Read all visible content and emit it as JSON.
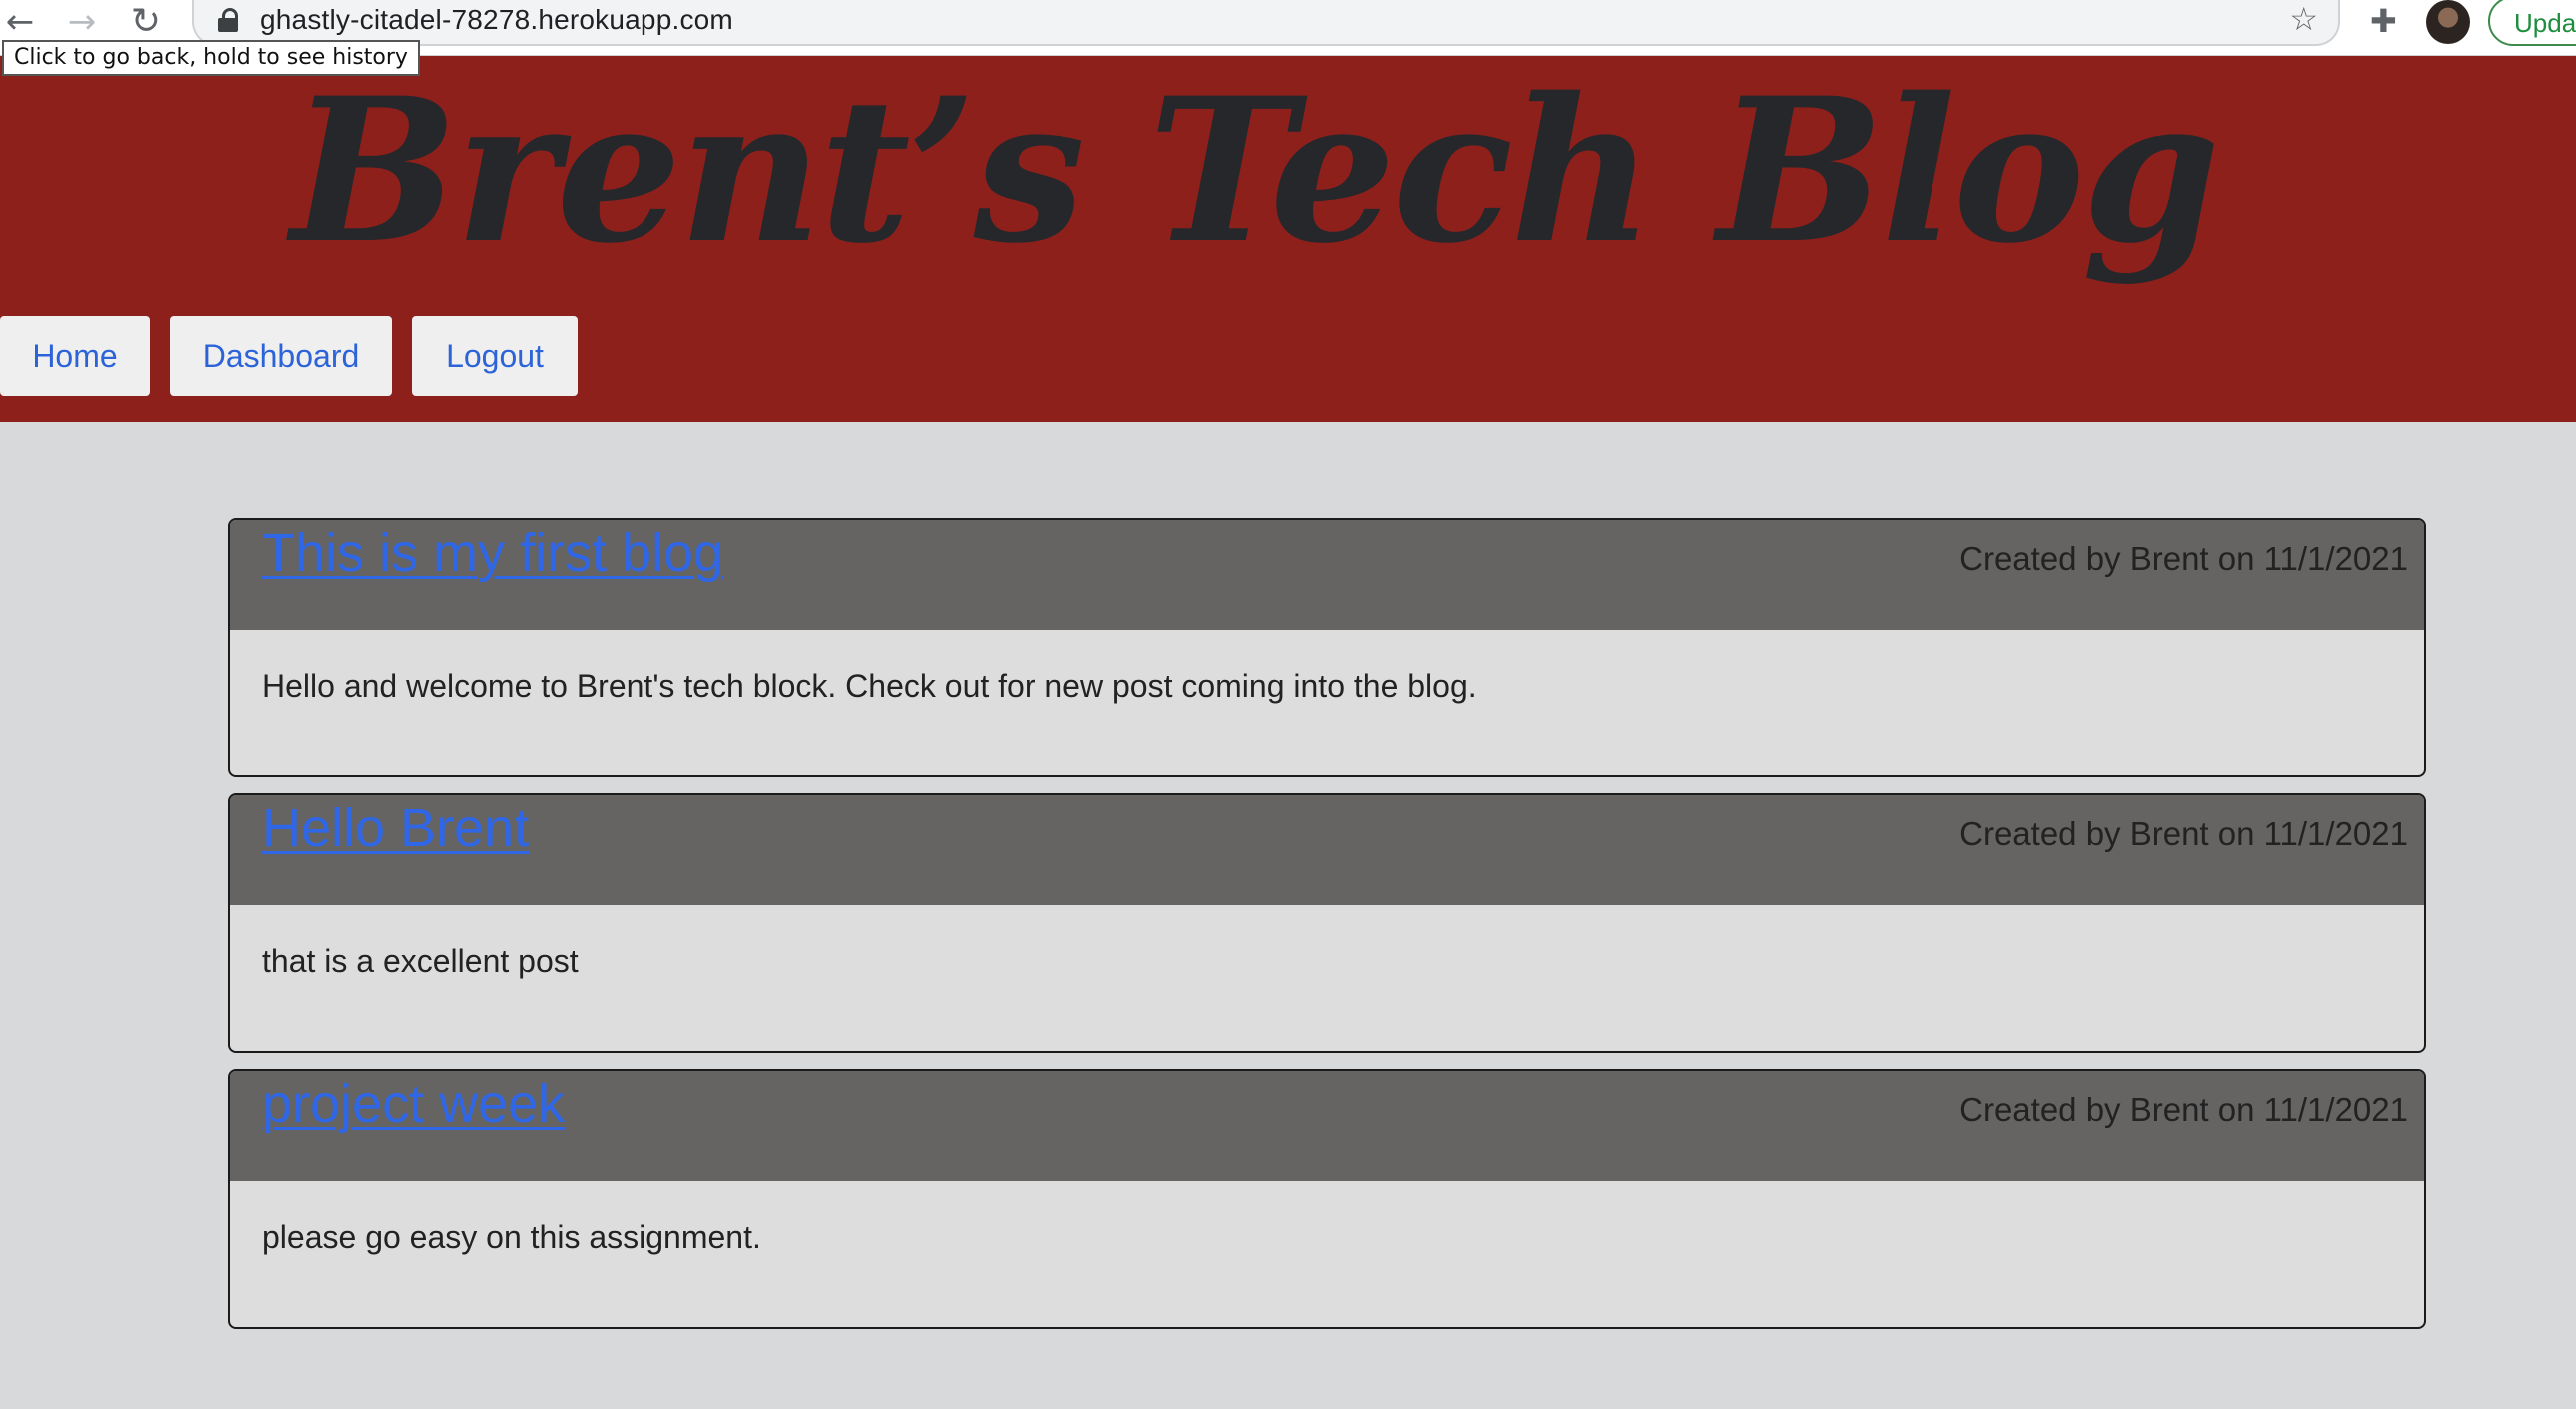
{
  "browser": {
    "url": "ghastly-citadel-78278.herokuapp.com",
    "tooltip": "Click to go back, hold to see history",
    "update_label": "Upda",
    "icons": [
      "back-arrow-icon",
      "forward-arrow-icon",
      "reload-icon",
      "lock-icon",
      "star-icon",
      "puzzle-icon",
      "avatar"
    ]
  },
  "site": {
    "title": "Brent’s Tech Blog",
    "header_color": "#8e201c",
    "nav": {
      "home": "Home",
      "dashboard": "Dashboard",
      "logout": "Logout"
    }
  },
  "posts": [
    {
      "title": "This is my first blog",
      "meta": "Created by Brent on 11/1/2021",
      "body": "Hello and welcome to Brent's tech block. Check out for new post coming into the blog."
    },
    {
      "title": "Hello Brent",
      "meta": "Created by Brent on 11/1/2021",
      "body": "that is a excellent post"
    },
    {
      "title": "project week",
      "meta": "Created by Brent on 11/1/2021",
      "body": "please go easy on this assignment."
    }
  ]
}
